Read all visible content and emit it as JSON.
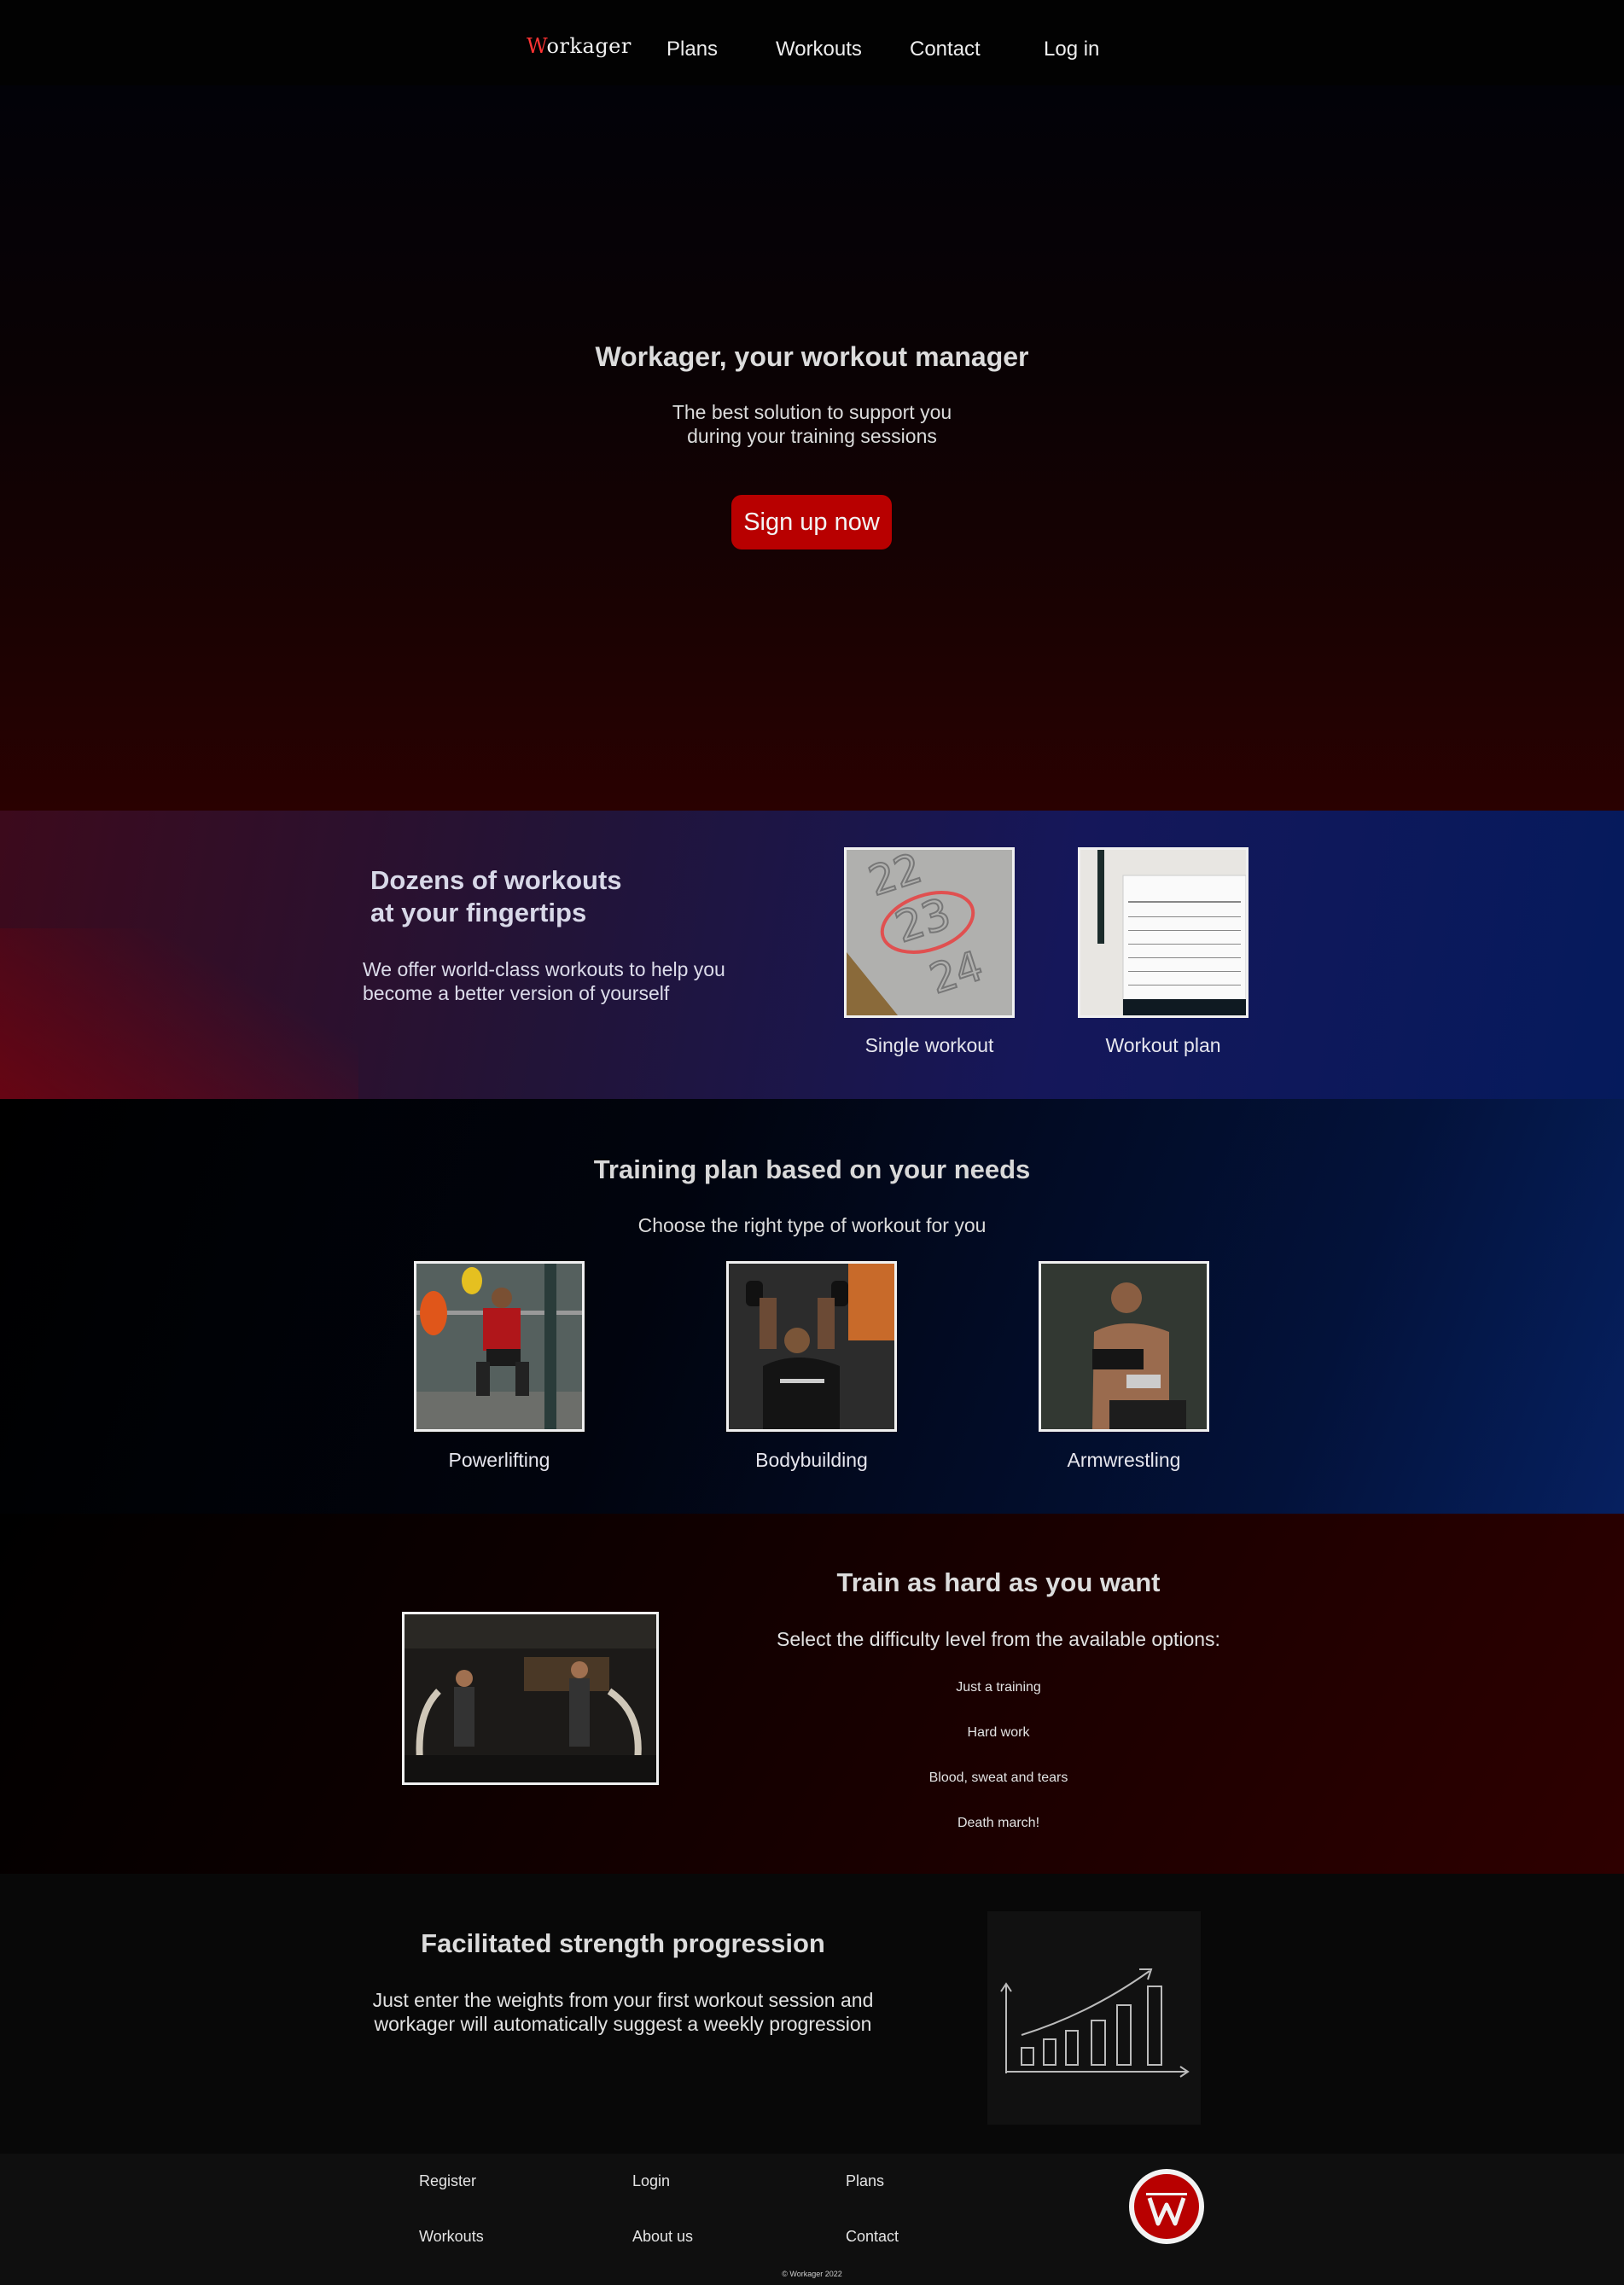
{
  "nav": {
    "logo": "Workager",
    "links": [
      "Plans",
      "Workouts",
      "Contact",
      "Log in"
    ]
  },
  "hero": {
    "title": "Workager, your workout manager",
    "subtitle_line1": "The best solution to support you",
    "subtitle_line2": "during your training sessions",
    "cta": "Sign up now"
  },
  "workouts": {
    "heading_line1": "Dozens of workouts",
    "heading_line2": "at your fingertips",
    "text_line1": "We offer world-class workouts to help you",
    "text_line2": "become a better version of yourself",
    "cards": [
      "Single workout",
      "Workout plan"
    ]
  },
  "training": {
    "title": "Training plan based on your needs",
    "subtitle": "Choose the right type of workout for you",
    "types": [
      "Powerlifting",
      "Bodybuilding",
      "Armwrestling"
    ]
  },
  "difficulty": {
    "title": "Train as hard as you want",
    "subtitle": "Select the difficulty level from the available options:",
    "options": [
      "Just a training",
      "Hard work",
      "Blood, sweat and tears",
      "Death march!"
    ]
  },
  "progression": {
    "title": "Facilitated strength progression",
    "text_line1": "Just enter the weights from your first workout session and",
    "text_line2": "workager will automatically suggest a weekly progression"
  },
  "footer": {
    "links": [
      "Register",
      "Login",
      "Plans",
      "Workouts",
      "About us",
      "Contact"
    ],
    "copyright": "© Workager 2022"
  },
  "colors": {
    "accent": "#b80000",
    "background": "#000000",
    "text": "#e0e0e0"
  }
}
